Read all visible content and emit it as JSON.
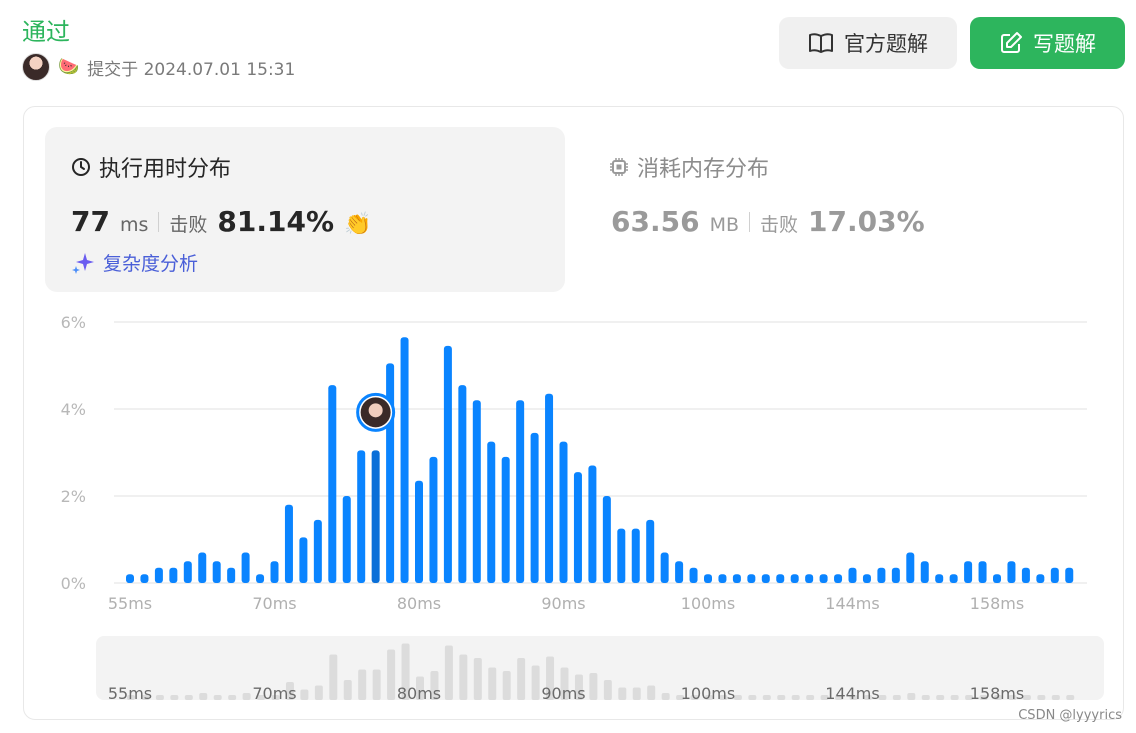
{
  "header": {
    "status": "通过",
    "submitted_text": "提交于 2024.07.01 15:31",
    "official_solution_label": "官方题解",
    "write_solution_label": "写题解"
  },
  "runtime": {
    "title": "执行用时分布",
    "value": "77",
    "unit": "ms",
    "beat_label": "击败",
    "beat_value": "81.14%",
    "complexity_label": "复杂度分析"
  },
  "memory": {
    "title": "消耗内存分布",
    "value": "63.56",
    "unit": "MB",
    "beat_label": "击败",
    "beat_value": "17.03%"
  },
  "chart_data": {
    "type": "bar",
    "ylim": [
      0,
      6
    ],
    "yticks": [
      "6%",
      "4%",
      "2%",
      "0%"
    ],
    "xtick_labels": [
      "55ms",
      "70ms",
      "80ms",
      "90ms",
      "100ms",
      "144ms",
      "158ms"
    ],
    "xtick_bar_index": [
      0,
      10,
      20,
      30,
      40,
      50,
      60
    ],
    "values": [
      0.2,
      0.2,
      0.35,
      0.35,
      0.5,
      0.7,
      0.5,
      0.35,
      0.7,
      0.2,
      0.5,
      1.8,
      1.05,
      1.45,
      4.55,
      2.0,
      3.05,
      3.05,
      5.05,
      5.65,
      2.35,
      2.9,
      5.45,
      4.55,
      4.2,
      3.25,
      2.9,
      4.2,
      3.45,
      4.35,
      3.25,
      2.55,
      2.7,
      2.0,
      1.25,
      1.25,
      1.45,
      0.7,
      0.5,
      0.35,
      0.2,
      0.2,
      0.2,
      0.2,
      0.2,
      0.2,
      0.2,
      0.2,
      0.2,
      0.2,
      0.35,
      0.2,
      0.35,
      0.35,
      0.7,
      0.5,
      0.2,
      0.2,
      0.5,
      0.5,
      0.2,
      0.5,
      0.35,
      0.2,
      0.35,
      0.35
    ],
    "highlight_index": 17,
    "bar_color": "#0a84ff",
    "highlight_color": "#0a6fd8",
    "grid": true
  },
  "watermark": "CSDN @lyyyrics",
  "colors": {
    "accent": "#2db55d",
    "bar": "#0a84ff"
  }
}
